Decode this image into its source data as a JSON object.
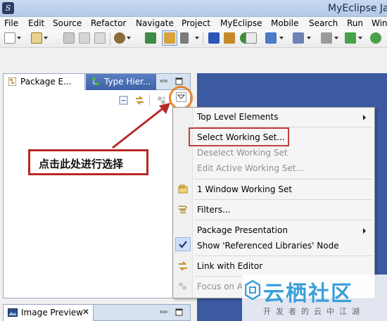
{
  "window": {
    "title": "MyEclipse Ja"
  },
  "menubar": {
    "items": [
      "File",
      "Edit",
      "Source",
      "Refactor",
      "Navigate",
      "Project",
      "MyEclipse",
      "Mobile",
      "Search",
      "Run",
      "Win"
    ]
  },
  "toolbar": {
    "icons": [
      "new-icon",
      "new-project-icon",
      "save-icon",
      "save-all-icon",
      "print-icon",
      "deploy-icon",
      "open-perspective-icon",
      "select-icon",
      "build-icon",
      "java-icon",
      "package-icon",
      "class-icon",
      "app-server-icon",
      "browser-icon",
      "search-icon",
      "run-icon",
      "debug-icon"
    ]
  },
  "view": {
    "tabs": [
      {
        "label": "Package E...",
        "icon": "package-explorer-icon"
      },
      {
        "label": "Type Hier...",
        "icon": "type-hierarchy-icon"
      }
    ],
    "actions": [
      "collapse-all-icon",
      "link-with-editor-icon",
      "focus-icon",
      "view-menu-icon"
    ]
  },
  "context_menu": {
    "items": [
      {
        "label": "Top Level Elements",
        "enabled": true,
        "submenu": true
      },
      {
        "label": "Select Working Set...",
        "enabled": true,
        "highlighted": true
      },
      {
        "label": "Deselect Working Set",
        "enabled": false
      },
      {
        "label": "Edit Active Working Set...",
        "enabled": false
      },
      {
        "label": "1 Window Working Set",
        "enabled": true,
        "icon": "working-set-icon"
      },
      {
        "label": "Filters...",
        "enabled": true,
        "icon": "filter-icon"
      },
      {
        "label": "Package Presentation",
        "enabled": true,
        "submenu": true
      },
      {
        "label": "Show 'Referenced Libraries' Node",
        "enabled": true,
        "checked": true
      },
      {
        "label": "Link with Editor",
        "enabled": true,
        "icon": "link-icon"
      },
      {
        "label": "Focus on A",
        "enabled": false,
        "icon": "focus-icon"
      }
    ]
  },
  "annotation": {
    "text": "点击此处进行选择",
    "color": "#b62a23"
  },
  "bottom_view": {
    "tab_label": "Image Preview",
    "icon": "image-preview-icon"
  },
  "watermark": {
    "main": "云栖社区",
    "sub": "开发者的云中江湖"
  },
  "colors": {
    "accent": "#e8862a",
    "highlight_box": "#c0403a",
    "editor_bg": "#3b5aa0",
    "tab_inactive": "#4a6db3"
  }
}
